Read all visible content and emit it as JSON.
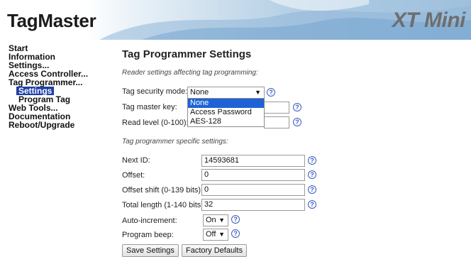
{
  "header": {
    "brand": "TagMaster",
    "product": "XT Mini"
  },
  "nav": {
    "items": [
      {
        "label": "Start"
      },
      {
        "label": "Information"
      },
      {
        "label": "Settings..."
      },
      {
        "label": "Access Controller..."
      },
      {
        "label": "Tag Programmer..."
      },
      {
        "label": "Settings",
        "active": true
      },
      {
        "label": "Program Tag"
      },
      {
        "label": "Web Tools..."
      },
      {
        "label": "Documentation"
      },
      {
        "label": "Reboot/Upgrade"
      }
    ]
  },
  "main": {
    "title": "Tag Programmer Settings",
    "reader_note": "Reader settings affecting tag programming:",
    "security_mode": {
      "label": "Tag security mode:",
      "value": "None",
      "options": [
        "None",
        "Access Password",
        "AES-128"
      ]
    },
    "master_key": {
      "label": "Tag master key:",
      "value": ""
    },
    "read_level": {
      "label": "Read level (0-100):",
      "value": ""
    },
    "specific_note": "Tag programmer specific settings:",
    "next_id": {
      "label": "Next ID:",
      "value": "14593681"
    },
    "offset": {
      "label": "Offset:",
      "value": "0"
    },
    "offset_shift": {
      "label": "Offset shift (0-139 bits):",
      "value": "0"
    },
    "total_length": {
      "label": "Total length (1-140 bits):",
      "value": "32"
    },
    "auto_increment": {
      "label": "Auto-increment:",
      "value": "On"
    },
    "program_beep": {
      "label": "Program beep:",
      "value": "Off"
    },
    "save_button": "Save Settings",
    "defaults_button": "Factory Defaults",
    "help_glyph": "?"
  }
}
